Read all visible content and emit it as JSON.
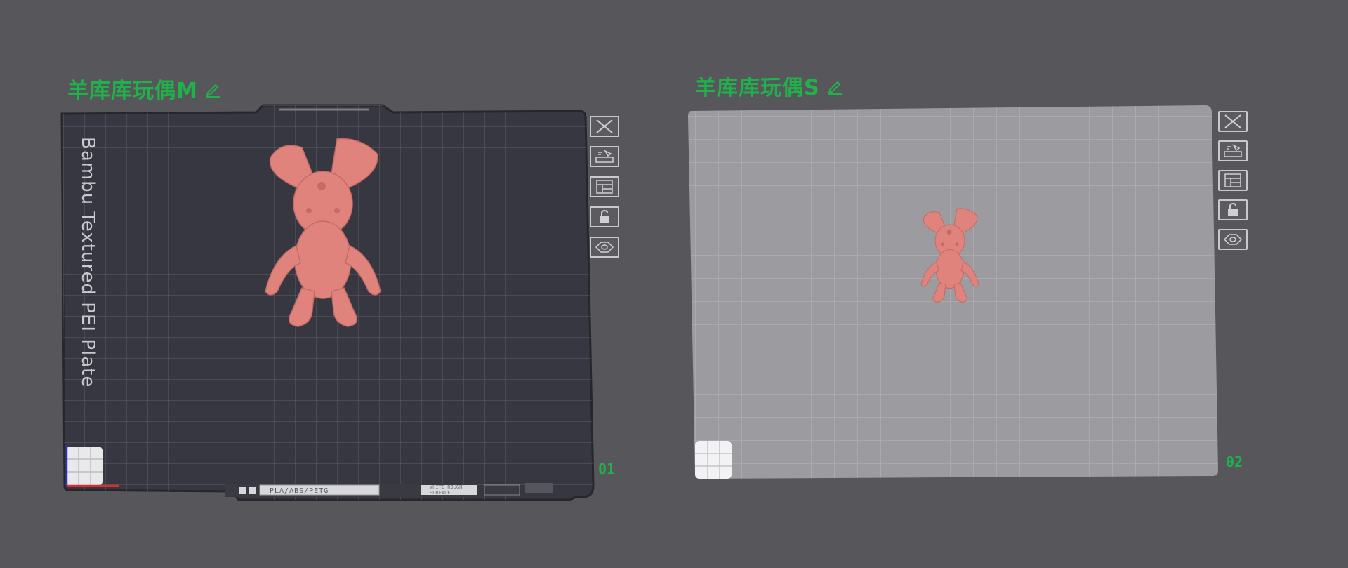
{
  "plates": [
    {
      "title": "羊库库玩偶M",
      "number": "01",
      "plate_type": "Bambu Textured PEI Plate",
      "filament": "PLA/ABS/PETG",
      "surface": "WHITE ROUGH SURFACE"
    },
    {
      "title": "羊库库玩偶S",
      "number": "02"
    }
  ],
  "toolbar_icons": [
    "close-icon",
    "arrange-icon",
    "layout-icon",
    "lock-icon",
    "eye-icon"
  ],
  "colors": {
    "background": "#57565b",
    "accent_green": "#20b24a",
    "dark_plate": "#36363d",
    "light_plate": "#9a9a9e",
    "model": "#e0837c"
  }
}
